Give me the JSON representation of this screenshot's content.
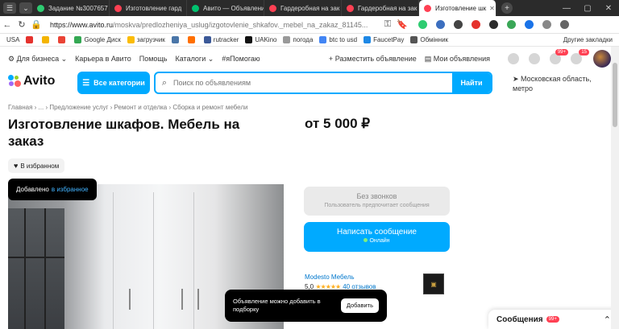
{
  "browser": {
    "tabs": [
      {
        "label": "Задание №3007657",
        "color": "#2ecc71"
      },
      {
        "label": "Изготовление гард",
        "color": "#ff4053"
      },
      {
        "label": "Авито — Объявлени",
        "color": "#00c26f"
      },
      {
        "label": "Гардеробная на зак",
        "color": "#ff4053"
      },
      {
        "label": "Гардеробная на зак",
        "color": "#ff4053"
      },
      {
        "label": "Изготовление шк",
        "color": "#ff4053"
      }
    ],
    "url_host": "https://www.avito.ru",
    "url_path": "/moskva/predlozheniya_uslug/izgotovlenie_shkafov._mebel_na_zakaz_81145..."
  },
  "bookmarks": {
    "items": [
      "USA",
      "Google Диск",
      "загрузчик",
      "rutracker",
      "UAKino",
      "погода",
      "btc to usd",
      "FaucetPay",
      "Обмінник"
    ],
    "other": "Другие закладки"
  },
  "topnav": {
    "business": "Для бизнеса",
    "career": "Карьера в Авито",
    "help": "Помощь",
    "catalogs": "Каталоги",
    "hashtag": "#яПомогаю",
    "post_ad": "Разместить объявление",
    "my_ads": "Мои объявления",
    "notif_badge": "99+",
    "cart_badge": "15"
  },
  "header": {
    "logo": "Avito",
    "categories": "Все категории",
    "search_placeholder": "Поиск по объявлениям",
    "search_button": "Найти",
    "location": "Московская область, метро"
  },
  "listing": {
    "breadcrumb": "Главная › ... › Предложение услуг › Ремонт и отделка › Сборка и ремонт мебели",
    "title": "Изготовление шкафов. Мебель на заказ",
    "price": "от 5 000 ₽",
    "favorite": "В избранном",
    "added_text": "Добавлено",
    "added_link": "в избранное",
    "no_calls": "Без звонков",
    "no_calls_sub": "Пользователь предпочитает сообщения",
    "write": "Написать сообщение",
    "online": "Онлайн",
    "seller_name": "Modesto Мебель",
    "seller_rating": "5,0",
    "seller_stars": "★★★★★",
    "seller_reviews": "40 отзывов"
  },
  "toast": {
    "text": "Объявление можно добавить в подборку",
    "button": "Добавить"
  },
  "messenger": {
    "label": "Сообщения",
    "badge": "99+"
  }
}
